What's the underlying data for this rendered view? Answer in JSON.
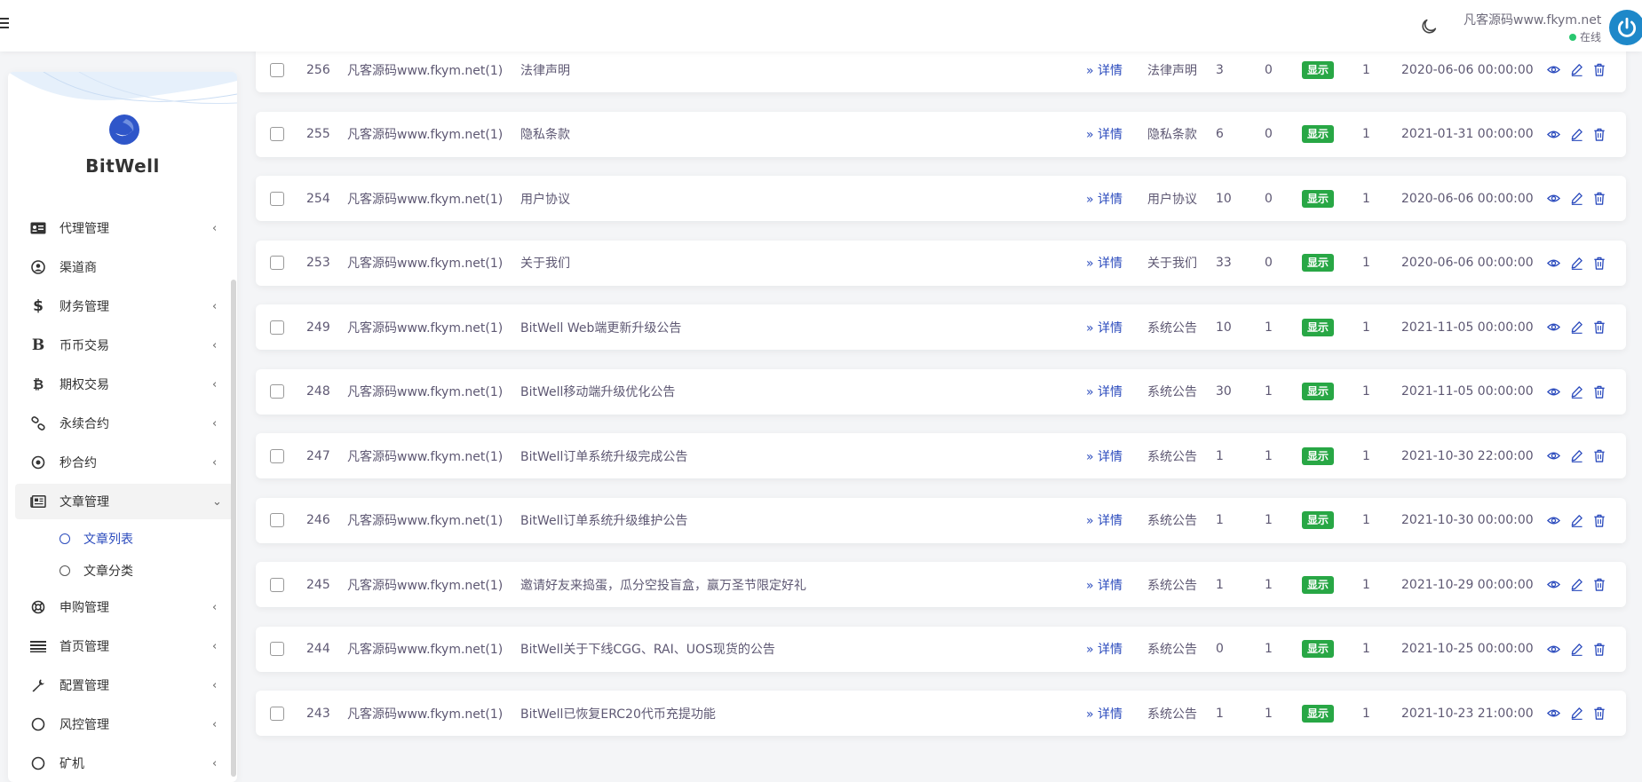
{
  "header": {
    "user_name": "凡客源码www.fkym.net",
    "status": "在线"
  },
  "sidebar": {
    "brand": "BitWell",
    "items": [
      {
        "label": "代理管理",
        "icon": "id-card-icon",
        "chevron": "‹"
      },
      {
        "label": "渠道商",
        "icon": "user-circle-icon",
        "chevron": ""
      },
      {
        "label": "财务管理",
        "icon": "dollar-icon",
        "chevron": "‹"
      },
      {
        "label": "币币交易",
        "icon": "b-letter-icon",
        "chevron": "‹"
      },
      {
        "label": "期权交易",
        "icon": "bitcoin-icon",
        "chevron": "‹"
      },
      {
        "label": "永续合约",
        "icon": "link-icon",
        "chevron": "‹"
      },
      {
        "label": "秒合约",
        "icon": "target-icon",
        "chevron": "‹"
      },
      {
        "label": "文章管理",
        "icon": "newspaper-icon",
        "chevron": "⌄"
      },
      {
        "label": "申购管理",
        "icon": "lifebuoy-icon",
        "chevron": "‹"
      },
      {
        "label": "首页管理",
        "icon": "list-icon",
        "chevron": "‹"
      },
      {
        "label": "配置管理",
        "icon": "wrench-icon",
        "chevron": "‹"
      },
      {
        "label": "风控管理",
        "icon": "circle-icon",
        "chevron": "‹"
      },
      {
        "label": "矿机",
        "icon": "circle-icon",
        "chevron": "‹"
      }
    ],
    "sub_items": [
      {
        "label": "文章列表",
        "active": true
      },
      {
        "label": "文章分类",
        "active": false
      }
    ]
  },
  "table": {
    "detail_label": "» 详情",
    "badge_label": "显示",
    "rows": [
      {
        "id": "256",
        "author": "凡客源码www.fkym.net(1)",
        "title": "法律声明",
        "category": "法律声明",
        "views": "3",
        "top": "0",
        "sort": "1",
        "date": "2020-06-06 00:00:00"
      },
      {
        "id": "255",
        "author": "凡客源码www.fkym.net(1)",
        "title": "隐私条款",
        "category": "隐私条款",
        "views": "6",
        "top": "0",
        "sort": "1",
        "date": "2021-01-31 00:00:00"
      },
      {
        "id": "254",
        "author": "凡客源码www.fkym.net(1)",
        "title": "用户协议",
        "category": "用户协议",
        "views": "10",
        "top": "0",
        "sort": "1",
        "date": "2020-06-06 00:00:00"
      },
      {
        "id": "253",
        "author": "凡客源码www.fkym.net(1)",
        "title": "关于我们",
        "category": "关于我们",
        "views": "33",
        "top": "0",
        "sort": "1",
        "date": "2020-06-06 00:00:00"
      },
      {
        "id": "249",
        "author": "凡客源码www.fkym.net(1)",
        "title": "BitWell Web端更新升级公告",
        "category": "系统公告",
        "views": "10",
        "top": "1",
        "sort": "1",
        "date": "2021-11-05 00:00:00"
      },
      {
        "id": "248",
        "author": "凡客源码www.fkym.net(1)",
        "title": "BitWell移动端升级优化公告",
        "category": "系统公告",
        "views": "30",
        "top": "1",
        "sort": "1",
        "date": "2021-11-05 00:00:00"
      },
      {
        "id": "247",
        "author": "凡客源码www.fkym.net(1)",
        "title": "BitWell订单系统升级完成公告",
        "category": "系统公告",
        "views": "1",
        "top": "1",
        "sort": "1",
        "date": "2021-10-30 22:00:00"
      },
      {
        "id": "246",
        "author": "凡客源码www.fkym.net(1)",
        "title": "BitWell订单系统升级维护公告",
        "category": "系统公告",
        "views": "1",
        "top": "1",
        "sort": "1",
        "date": "2021-10-30 00:00:00"
      },
      {
        "id": "245",
        "author": "凡客源码www.fkym.net(1)",
        "title": "邀请好友来捣蛋，瓜分空投盲盒，赢万圣节限定好礼",
        "category": "系统公告",
        "views": "1",
        "top": "1",
        "sort": "1",
        "date": "2021-10-29 00:00:00"
      },
      {
        "id": "244",
        "author": "凡客源码www.fkym.net(1)",
        "title": "BitWell关于下线CGG、RAI、UOS现货的公告",
        "category": "系统公告",
        "views": "0",
        "top": "1",
        "sort": "1",
        "date": "2021-10-25 00:00:00"
      },
      {
        "id": "243",
        "author": "凡客源码www.fkym.net(1)",
        "title": "BitWell已恢复ERC20代币充提功能",
        "category": "系统公告",
        "views": "1",
        "top": "1",
        "sort": "1",
        "date": "2021-10-23 21:00:00"
      }
    ]
  },
  "colors": {
    "accent": "#2b4bbd",
    "badge": "#28a745",
    "online": "#28c76f"
  }
}
